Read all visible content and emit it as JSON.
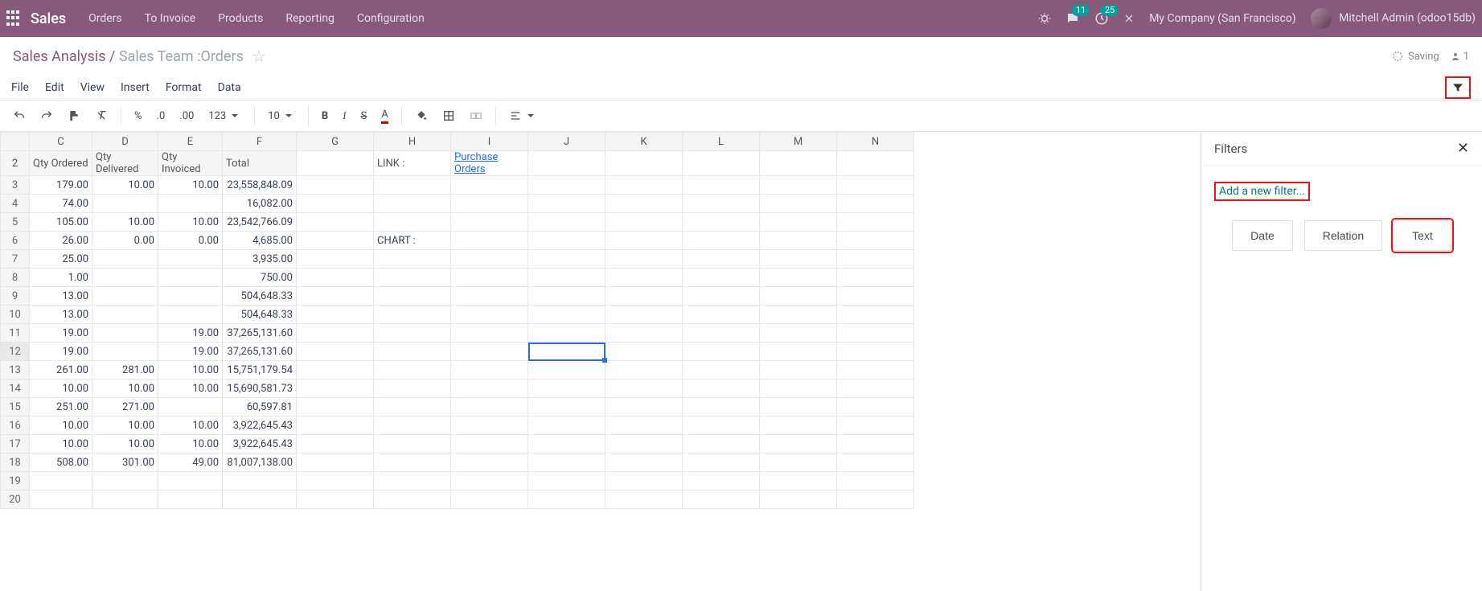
{
  "topbar": {
    "brand": "Sales",
    "links": [
      "Orders",
      "To Invoice",
      "Products",
      "Reporting",
      "Configuration"
    ],
    "chat_badge": "11",
    "activity_badge": "25",
    "company": "My Company (San Francisco)",
    "user": "Mitchell Admin (odoo15db)"
  },
  "breadcrumb": {
    "root": "Sales Analysis",
    "sep": " / ",
    "leaf": "Sales Team :Orders",
    "saving": "Saving",
    "user_count": "1"
  },
  "menu": {
    "items": [
      "File",
      "Edit",
      "View",
      "Insert",
      "Format",
      "Data"
    ]
  },
  "toolbar": {
    "undo": "undo",
    "redo": "redo",
    "paint": "paint",
    "clearfmt": "clearfmt",
    "pct": "%",
    "dec1": ".0",
    "dec2": ".00",
    "numfmt": "123",
    "fontsize": "10",
    "bold": "B",
    "italic": "I",
    "strike": "S",
    "textcolor": "A",
    "fill": "fill",
    "border": "border",
    "merge": "merge",
    "align": "align"
  },
  "columns": [
    "C",
    "D",
    "E",
    "F",
    "G",
    "H",
    "I",
    "J",
    "K",
    "L",
    "M",
    "N"
  ],
  "headers": {
    "C": "Qty Ordered",
    "D": "Qty Delivered",
    "E": "Qty Invoiced",
    "F": "Total"
  },
  "link_label": "LINK :",
  "link_text": "Purchase Orders",
  "chart_label": "CHART :",
  "rows": [
    {
      "n": 3,
      "C": "179.00",
      "D": "10.00",
      "E": "10.00",
      "F": "23,558,848.09"
    },
    {
      "n": 4,
      "C": "74.00",
      "D": "",
      "E": "",
      "F": "16,082.00"
    },
    {
      "n": 5,
      "C": "105.00",
      "D": "10.00",
      "E": "10.00",
      "F": "23,542,766.09"
    },
    {
      "n": 6,
      "C": "26.00",
      "D": "0.00",
      "E": "0.00",
      "F": "4,685.00"
    },
    {
      "n": 7,
      "C": "25.00",
      "D": "",
      "E": "",
      "F": "3,935.00"
    },
    {
      "n": 8,
      "C": "1.00",
      "D": "",
      "E": "",
      "F": "750.00"
    },
    {
      "n": 9,
      "C": "13.00",
      "D": "",
      "E": "",
      "F": "504,648.33"
    },
    {
      "n": 10,
      "C": "13.00",
      "D": "",
      "E": "",
      "F": "504,648.33"
    },
    {
      "n": 11,
      "C": "19.00",
      "D": "",
      "E": "19.00",
      "F": "37,265,131.60"
    },
    {
      "n": 12,
      "C": "19.00",
      "D": "",
      "E": "19.00",
      "F": "37,265,131.60"
    },
    {
      "n": 13,
      "C": "261.00",
      "D": "281.00",
      "E": "10.00",
      "F": "15,751,179.54"
    },
    {
      "n": 14,
      "C": "10.00",
      "D": "10.00",
      "E": "10.00",
      "F": "15,690,581.73"
    },
    {
      "n": 15,
      "C": "251.00",
      "D": "271.00",
      "E": "",
      "F": "60,597.81"
    },
    {
      "n": 16,
      "C": "10.00",
      "D": "10.00",
      "E": "10.00",
      "F": "3,922,645.43"
    },
    {
      "n": 17,
      "C": "10.00",
      "D": "10.00",
      "E": "10.00",
      "F": "3,922,645.43"
    },
    {
      "n": 18,
      "C": "508.00",
      "D": "301.00",
      "E": "49.00",
      "F": "81,007,138.00"
    },
    {
      "n": 19,
      "C": "",
      "D": "",
      "E": "",
      "F": ""
    },
    {
      "n": 20,
      "C": "",
      "D": "",
      "E": "",
      "F": ""
    }
  ],
  "panel": {
    "title": "Filters",
    "add": "Add a new filter...",
    "btn_date": "Date",
    "btn_rel": "Relation",
    "btn_text": "Text"
  }
}
